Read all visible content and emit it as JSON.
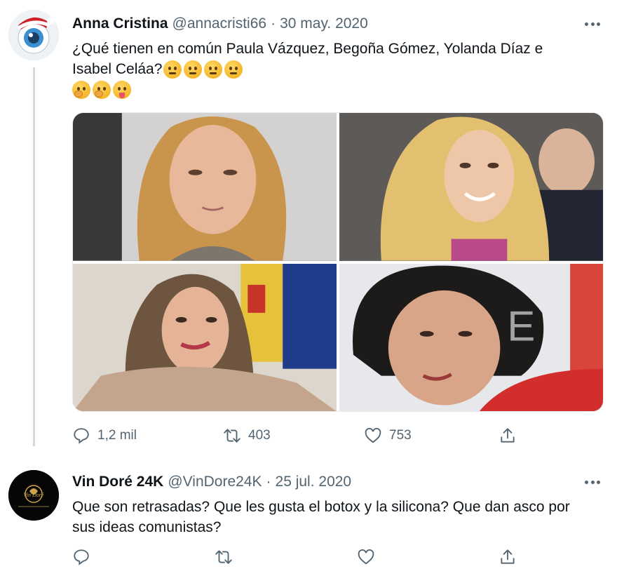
{
  "tweets": [
    {
      "author": {
        "name": "Anna Cristina",
        "handle": "@annacristi66",
        "date": "30 may. 2020"
      },
      "text_line1": "¿Qué tienen en común Paula Vázquez, Begoña Gómez, Yolanda Díaz e",
      "text_line2": "Isabel Celáa?",
      "emojis_line2": [
        "thinking-emoji",
        "thinking-emoji",
        "thinking-emoji",
        "thinking-emoji"
      ],
      "emojis_line3": [
        "hand-over-mouth-emoji",
        "hand-over-mouth-emoji",
        "squinting-tongue-emoji"
      ],
      "media": [
        "photo-woman-blonde-hair",
        "photo-woman-smiling-blonde",
        "photo-woman-speaking-flags",
        "photo-woman-dark-curly-hair"
      ],
      "stats": {
        "replies": "1,2 mil",
        "retweets": "403",
        "likes": "753"
      }
    },
    {
      "author": {
        "name": "Vin Doré 24K",
        "handle": "@VinDore24K",
        "date": "25 jul. 2020"
      },
      "text_line1": "Que son retrasadas? Que les gusta el botox y la silicona? Que dan asco por",
      "text_line2": "sus ideas comunistas?",
      "avatar_text": "Vin Doré",
      "stats": {
        "replies": "",
        "retweets": "",
        "likes": ""
      }
    }
  ],
  "icons": [
    "reply-icon",
    "retweet-icon",
    "like-icon",
    "share-icon",
    "more-icon"
  ],
  "colors": {
    "text": "#0f1419",
    "secondary": "#536471",
    "thread_line": "#cfd9de"
  }
}
